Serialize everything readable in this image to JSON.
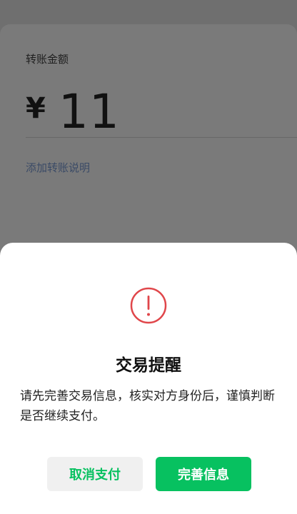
{
  "transfer": {
    "amount_label": "转账金额",
    "currency_symbol": "¥",
    "amount": "11",
    "add_note_label": "添加转账说明"
  },
  "dialog": {
    "icon": "exclamation-circle-icon",
    "title": "交易提醒",
    "message": "请先完善交易信息，核实对方身份后，谨慎判断是否继续支付。",
    "cancel_label": "取消支付",
    "confirm_label": "完善信息"
  },
  "colors": {
    "accent_green": "#07c160",
    "warning_red": "#e0464a",
    "overlay_gray": "#707070"
  }
}
